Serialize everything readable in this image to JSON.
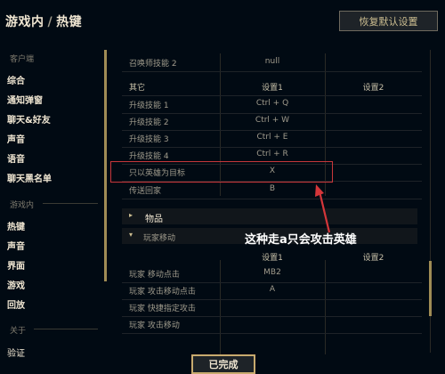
{
  "header": {
    "title_main": "游戏内",
    "title_sep": "/",
    "title_sub": "热键",
    "reset_label": "恢复默认设置"
  },
  "sidebar": {
    "client_section": "客户端",
    "client_items": [
      "综合",
      "通知弹窗",
      "聊天&好友",
      "声音",
      "语音",
      "聊天黑名单"
    ],
    "ingame_section": "游戏内",
    "ingame_items": [
      "热键",
      "声音",
      "界面",
      "游戏",
      "回放"
    ],
    "about_section": "关于",
    "about_items": [
      "验证"
    ]
  },
  "table": {
    "top_row": {
      "name": "召唤师技能 2",
      "key1": "null",
      "key2": ""
    },
    "other_header": {
      "name": "其它",
      "key1": "设置1",
      "key2": "设置2"
    },
    "other_rows": [
      {
        "name": "升级技能 1",
        "key1": "Ctrl + Q",
        "key2": ""
      },
      {
        "name": "升级技能 2",
        "key1": "Ctrl + W",
        "key2": ""
      },
      {
        "name": "升级技能 3",
        "key1": "Ctrl + E",
        "key2": ""
      },
      {
        "name": "升级技能 4",
        "key1": "Ctrl + R",
        "key2": ""
      },
      {
        "name": "只以英雄为目标",
        "key1": "X",
        "key2": ""
      },
      {
        "name": "传送回家",
        "key1": "B",
        "key2": ""
      }
    ],
    "items_section": {
      "arrow": "▸",
      "label": "物品"
    },
    "move_section": {
      "arrow": "▾",
      "label": "玩家移动"
    },
    "move_header": {
      "name": "",
      "key1": "设置1",
      "key2": "设置2"
    },
    "move_rows": [
      {
        "name": "玩家 移动点击",
        "key1": "MB2",
        "key2": ""
      },
      {
        "name": "玩家 攻击移动点击",
        "key1": "A",
        "key2": ""
      },
      {
        "name": "玩家 快捷指定攻击",
        "key1": "",
        "key2": ""
      },
      {
        "name": "玩家 攻击移动",
        "key1": "",
        "key2": ""
      }
    ]
  },
  "annotation": "这种走a只会攻击英雄",
  "done_label": "已完成",
  "colors": {
    "gold": "#c8aa6e",
    "highlight": "#c8373b",
    "background": "#010a13"
  }
}
